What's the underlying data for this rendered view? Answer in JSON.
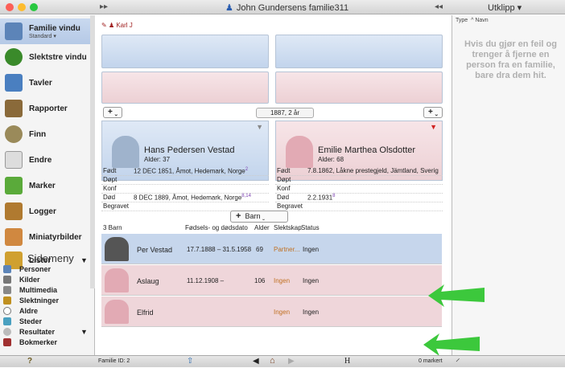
{
  "window": {
    "title": "John Gundersens familie311",
    "clipboard_title": "Utklipp"
  },
  "sidebar": {
    "items": [
      {
        "label": "Familie vindu",
        "sub": "Standard",
        "color": "#5c84b8"
      },
      {
        "label": "Slektstre vindu",
        "color": "#3a8a2a"
      },
      {
        "label": "Tavler",
        "color": "#4a7fc0"
      },
      {
        "label": "Rapporter",
        "color": "#8a6a3a"
      },
      {
        "label": "Finn",
        "color": "#9a8a5a"
      },
      {
        "label": "Endre",
        "color": "#888888"
      },
      {
        "label": "Marker",
        "color": "#5aaa3a"
      },
      {
        "label": "Logger",
        "color": "#b07a30"
      },
      {
        "label": "Miniatyrbilder",
        "color": "#d08840"
      },
      {
        "label": "Lister",
        "color": "#d0a030"
      }
    ],
    "sidemeny_title": "Sidemeny",
    "sidemeny": [
      "Personer",
      "Kilder",
      "Multimedia",
      "Slektninger",
      "Aldre",
      "Steder",
      "Resultater",
      "Bokmerker"
    ]
  },
  "main": {
    "edit_person": "Karl J",
    "year_label": "1887, 2 år",
    "father": {
      "name": "Hans Pedersen Vestad",
      "age": "Alder: 37",
      "events": [
        {
          "k": "Født",
          "v": "12 DEC 1851, Åmot, Hedemark, Norge",
          "sup": "2"
        },
        {
          "k": "Døpt",
          "v": ""
        },
        {
          "k": "Konf",
          "v": ""
        },
        {
          "k": "Død",
          "v": "8 DEC 1889, Åmot, Hedemark, Norge",
          "sup": "8,14"
        },
        {
          "k": "Begravet",
          "v": ""
        }
      ]
    },
    "mother": {
      "name": "Emilie Marthea Olsdotter",
      "age": "Alder: 68",
      "events": [
        {
          "k": "Født",
          "v": "7.8.1862, Låkne prestegjeld, Jämtland, Sverig",
          "sup": ""
        },
        {
          "k": "Døpt",
          "v": ""
        },
        {
          "k": "Konf",
          "v": ""
        },
        {
          "k": "Død",
          "v": "2.2.1931",
          "sup": "8"
        },
        {
          "k": "Begravet",
          "v": ""
        }
      ]
    },
    "barn_button": "Barn",
    "children_header": {
      "count": "3 Barn",
      "dates": "Fødsels- og dødsdato",
      "age": "Alder",
      "rel": "Slektskap",
      "status": "Status"
    },
    "children": [
      {
        "name": "Per Vestad",
        "dates": "17.7.1888 – 31.5.1958",
        "age": "69",
        "rel": "Partner...",
        "status": "Ingen"
      },
      {
        "name": "Aslaug",
        "dates": "11.12.1908 –",
        "age": "106",
        "rel": "Ingen",
        "status": "Ingen"
      },
      {
        "name": "Elfrid",
        "dates": "",
        "age": "",
        "rel": "Ingen",
        "status": "Ingen"
      }
    ]
  },
  "clipboard": {
    "col_type": "Type",
    "col_name": "Navn",
    "message": "Hvis du gjør en feil og trenger å fjerne en person fra en familie, bare dra dem hit."
  },
  "status": {
    "family_id": "Familie ID: 2",
    "marked": "0 markert",
    "help": "?",
    "h_label": "H"
  },
  "colors": {
    "arrow": "#3cc83c",
    "selected_row": "#c6d6ec",
    "pink_row": "#efd6da"
  }
}
